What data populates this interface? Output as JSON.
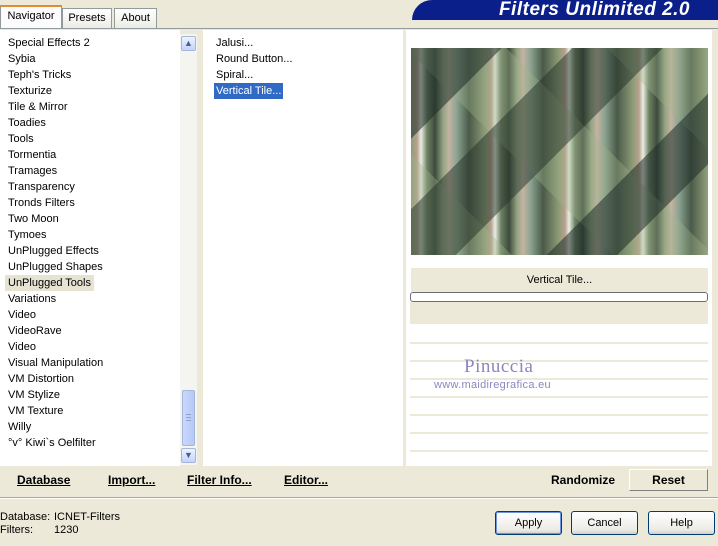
{
  "tabs": [
    "Navigator",
    "Presets",
    "About"
  ],
  "banner_title": "Filters Unlimited 2.0",
  "categories": [
    "Special Effects 2",
    "Sybia",
    "Teph's Tricks",
    "Texturize",
    "Tile & Mirror",
    "Toadies",
    "Tools",
    "Tormentia",
    "Tramages",
    "Transparency",
    "Tronds Filters",
    "Two Moon",
    "Tymoes",
    "UnPlugged Effects",
    "UnPlugged Shapes",
    "UnPlugged Tools",
    "Variations",
    "Video",
    "VideoRave",
    "Video",
    "Visual Manipulation",
    "VM Distortion",
    "VM Stylize",
    "VM Texture",
    "Willy",
    "°v° Kiwi`s Oelfilter"
  ],
  "selected_category": "UnPlugged Tools",
  "filters": [
    "Jalusi...",
    "Round Button...",
    "Spiral...",
    "Vertical Tile..."
  ],
  "selected_filter": "Vertical Tile...",
  "bottom_links": {
    "database": "Database",
    "import": "Import...",
    "filter_info": "Filter Info...",
    "editor": "Editor..."
  },
  "preview": {
    "filter_name": "Vertical Tile...",
    "progress": 0
  },
  "watermark": {
    "name": "Pinuccia",
    "url": "www.maidiregrafica.eu"
  },
  "actions": {
    "randomize": "Randomize",
    "reset": "Reset"
  },
  "status": {
    "database_label": "Database:",
    "database_value": "ICNET-Filters",
    "filters_label": "Filters:",
    "filters_value": "1230"
  },
  "buttons": {
    "apply": "Apply",
    "cancel": "Cancel",
    "help": "Help"
  },
  "icons": {
    "scroll_up": "scroll-up-arrow-icon",
    "scroll_down": "scroll-down-arrow-icon"
  }
}
